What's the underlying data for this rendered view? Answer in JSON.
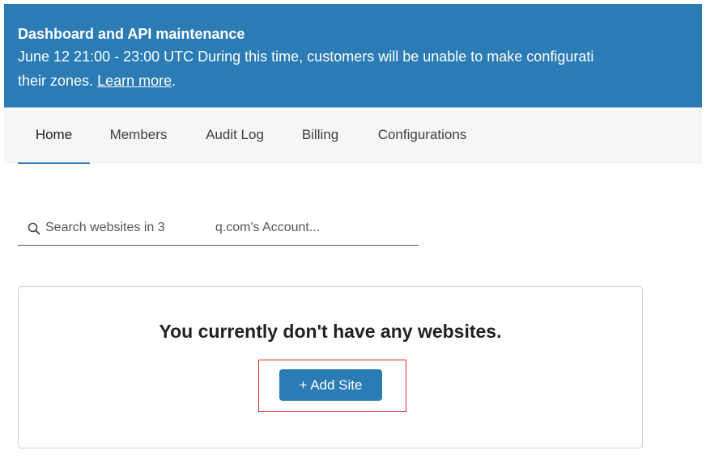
{
  "banner": {
    "title": "Dashboard and API maintenance",
    "line1": "June 12 21:00 - 23:00 UTC During this time, customers will be unable to make configurati",
    "line2_prefix": "their zones. ",
    "link_text": "Learn more",
    "line2_suffix": "."
  },
  "tabs": [
    {
      "label": "Home",
      "active": true
    },
    {
      "label": "Members",
      "active": false
    },
    {
      "label": "Audit Log",
      "active": false
    },
    {
      "label": "Billing",
      "active": false
    },
    {
      "label": "Configurations",
      "active": false
    }
  ],
  "search": {
    "placeholder": "Search websites in 3              q.com's Account..."
  },
  "empty_state": {
    "message": "You currently don't have any websites.",
    "button_label": "+ Add Site"
  },
  "colors": {
    "accent": "#2b7bb5",
    "highlight": "#e0282e"
  }
}
